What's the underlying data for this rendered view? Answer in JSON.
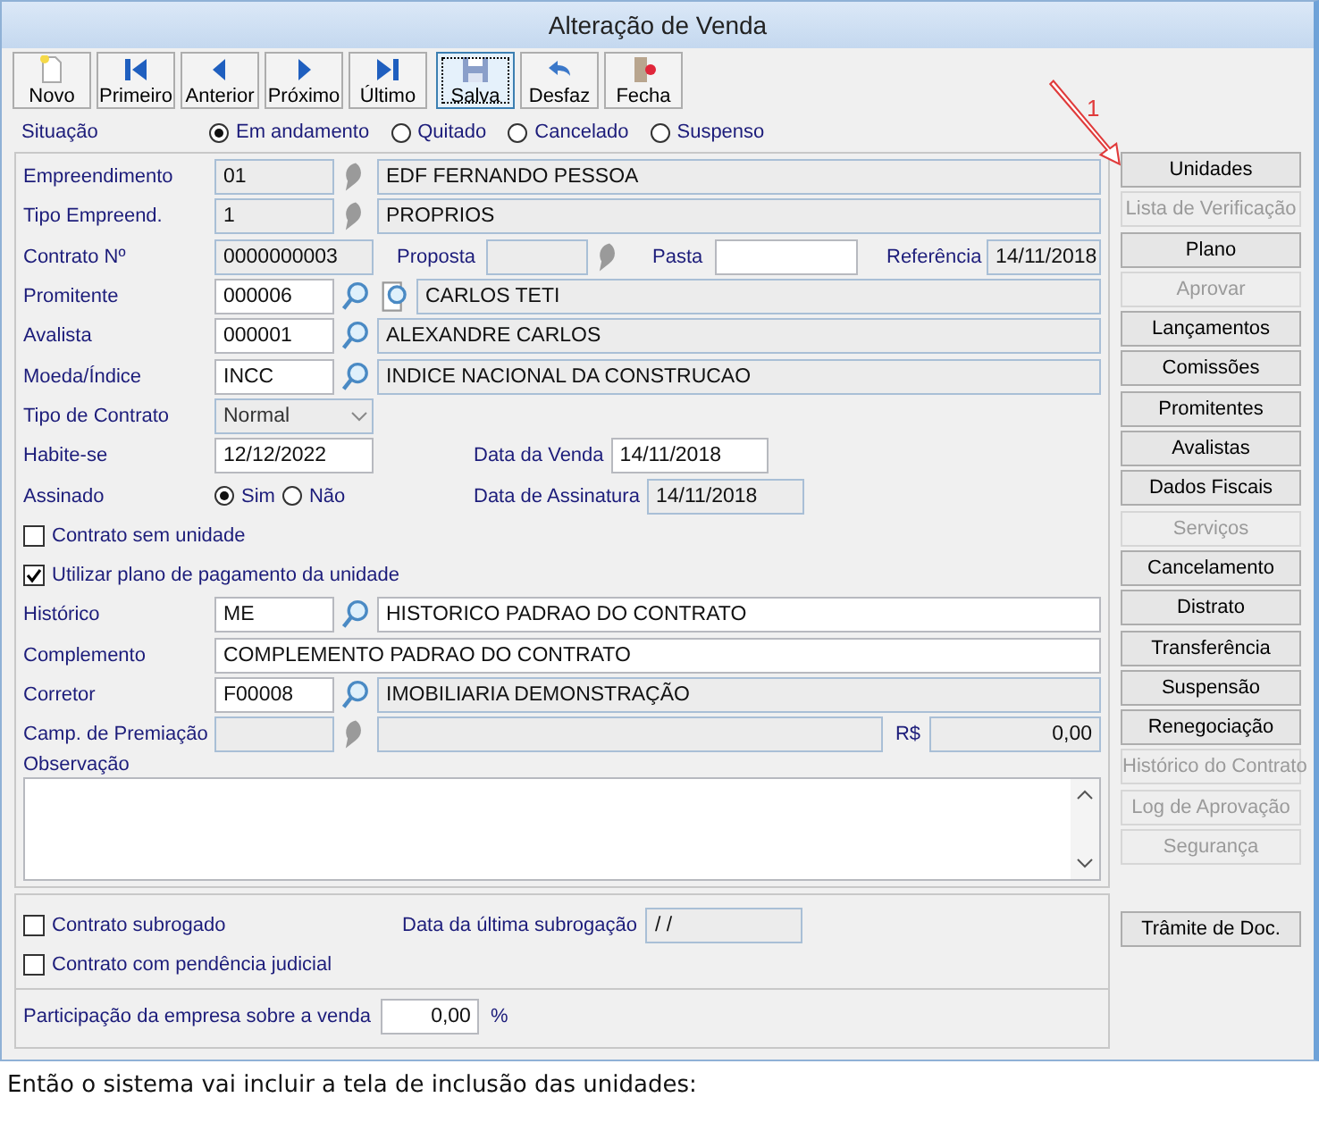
{
  "window": {
    "title": "Alteração de Venda"
  },
  "toolbar": [
    {
      "label": "Novo",
      "kind": "new",
      "focused": false
    },
    {
      "label": "Primeiro",
      "kind": "first",
      "focused": false
    },
    {
      "label": "Anterior",
      "kind": "prev",
      "focused": false
    },
    {
      "label": "Próximo",
      "kind": "next",
      "focused": false
    },
    {
      "label": "Último",
      "kind": "last",
      "focused": false
    },
    {
      "label": "Salva",
      "kind": "save",
      "focused": true
    },
    {
      "label": "Desfaz",
      "kind": "undo",
      "focused": false
    },
    {
      "label": "Fecha",
      "kind": "close",
      "focused": false
    }
  ],
  "situacao": {
    "label": "Situação",
    "options": [
      {
        "label": "Em andamento",
        "selected": true
      },
      {
        "label": "Quitado",
        "selected": false
      },
      {
        "label": "Cancelado",
        "selected": false
      },
      {
        "label": "Suspenso",
        "selected": false
      }
    ]
  },
  "rows": [
    {
      "kind": "lookup",
      "label": "Empreendimento",
      "code": {
        "value": "01",
        "editable": false
      },
      "lookup": {
        "enabled": false
      },
      "description": {
        "value": "EDF FERNANDO PESSOA",
        "editable": false
      }
    },
    {
      "kind": "lookup",
      "label": "Tipo Empreend.",
      "code": {
        "value": "1",
        "editable": false
      },
      "lookup": {
        "enabled": false
      },
      "description": {
        "value": "PROPRIOS",
        "editable": false
      }
    },
    {
      "kind": "contract",
      "label": "Contrato Nº",
      "number": {
        "value": "0000000003",
        "editable": false
      },
      "proposta_label": "Proposta",
      "proposta": {
        "editable": false
      },
      "proposta_lookup": {
        "enabled": false
      },
      "pasta_label": "Pasta",
      "pasta": {
        "editable": true
      },
      "referencia_label": "Referência",
      "referencia": {
        "value": "14/11/2018",
        "editable": false
      }
    },
    {
      "kind": "lookup",
      "label": "Promitente",
      "code": {
        "value": "000006",
        "editable": true
      },
      "lookup": {
        "enabled": true
      },
      "extra_lookup": {
        "enabled": true
      },
      "description": {
        "value": "CARLOS TETI",
        "editable": false
      }
    },
    {
      "kind": "lookup",
      "label": "Avalista",
      "code": {
        "value": "000001",
        "editable": true
      },
      "lookup": {
        "enabled": true
      },
      "description": {
        "value": "ALEXANDRE CARLOS",
        "editable": false
      }
    },
    {
      "kind": "lookup",
      "label": "Moeda/Índice",
      "code": {
        "value": "INCC",
        "editable": true
      },
      "lookup": {
        "enabled": true
      },
      "description": {
        "value": "INDICE NACIONAL DA CONSTRUCAO",
        "editable": false
      }
    },
    {
      "kind": "select",
      "label": "Tipo de Contrato",
      "value": "Normal",
      "disabled": true
    },
    {
      "kind": "date_pair",
      "label": "Habite-se",
      "field": {
        "value": "12/12/2022",
        "editable": true
      },
      "right_label": "Data da Venda",
      "right_field": {
        "value": "14/11/2018",
        "editable": true
      }
    },
    {
      "kind": "radio_date",
      "label": "Assinado",
      "options": [
        {
          "label": "Sim",
          "selected": true
        },
        {
          "label": "Não",
          "selected": false
        }
      ],
      "right_label": "Data de Assinatura",
      "right_field": {
        "value": "14/11/2018",
        "editable": false
      }
    },
    {
      "kind": "check",
      "label": "Contrato sem unidade",
      "checked": false
    },
    {
      "kind": "check",
      "label": "Utilizar plano de pagamento da unidade",
      "checked": true
    },
    {
      "kind": "lookup",
      "label": "Histórico",
      "code": {
        "value": "ME",
        "editable": true
      },
      "lookup": {
        "enabled": true
      },
      "description": {
        "value": "HISTORICO PADRAO DO CONTRATO",
        "editable": true
      }
    },
    {
      "kind": "text",
      "label": "Complemento",
      "field": {
        "value": "COMPLEMENTO PADRAO DO CONTRATO",
        "editable": true
      }
    },
    {
      "kind": "lookup",
      "label": "Corretor",
      "code": {
        "value": "F00008",
        "editable": true
      },
      "lookup": {
        "enabled": true
      },
      "description": {
        "value": "IMOBILIARIA DEMONSTRAÇÃO",
        "editable": false
      }
    },
    {
      "kind": "campaign",
      "label": "Camp. de Premiação",
      "code": {
        "editable": false
      },
      "lookup": {
        "enabled": false
      },
      "description": {
        "editable": false
      },
      "currency_label": "R$",
      "amount": {
        "value": "0,00",
        "editable": false
      }
    },
    {
      "kind": "memo",
      "label": "Observação"
    }
  ],
  "subrogacao": {
    "checks": [
      {
        "label": "Contrato subrogado",
        "checked": false
      },
      {
        "label": "Contrato com pendência judicial",
        "checked": false
      }
    ],
    "date_label": "Data da última subrogação",
    "date": {
      "value": "/ /",
      "editable": false
    }
  },
  "participacao": {
    "label": "Participação da empresa sobre a venda",
    "field": {
      "value": "0,00",
      "editable": true
    },
    "unit": "%"
  },
  "side_buttons": [
    {
      "label": "Unidades",
      "disabled": false,
      "kind": "action"
    },
    {
      "label": "Lista de Verificação",
      "disabled": true,
      "kind": "action"
    },
    {
      "label": "Plano",
      "disabled": false,
      "kind": "action"
    },
    {
      "label": "Aprovar",
      "disabled": true,
      "kind": "action"
    },
    {
      "label": "Lançamentos",
      "disabled": false,
      "kind": "action"
    },
    {
      "label": "Comissões",
      "disabled": false,
      "kind": "action"
    },
    {
      "label": "Promitentes",
      "disabled": false,
      "kind": "action"
    },
    {
      "label": "Avalistas",
      "disabled": false,
      "kind": "action"
    },
    {
      "label": "Dados Fiscais",
      "disabled": false,
      "kind": "action"
    },
    {
      "label": "Serviços",
      "disabled": true,
      "kind": "action"
    },
    {
      "label": "Cancelamento",
      "disabled": false,
      "kind": "action"
    },
    {
      "label": "Distrato",
      "disabled": false,
      "kind": "action"
    },
    {
      "label": "Transferência",
      "disabled": false,
      "kind": "action"
    },
    {
      "label": "Suspensão",
      "disabled": false,
      "kind": "action"
    },
    {
      "label": "Renegociação",
      "disabled": false,
      "kind": "action"
    },
    {
      "label": "Histórico do Contrato",
      "disabled": true,
      "kind": "action"
    },
    {
      "label": "Log de Aprovação",
      "disabled": true,
      "kind": "action"
    },
    {
      "label": "Segurança",
      "disabled": true,
      "kind": "action"
    },
    {
      "label": "Trâmite de Doc.",
      "disabled": false,
      "kind": "footer"
    }
  ],
  "annotation": {
    "label": "1"
  },
  "caption": "Então o sistema vai incluir a tela de inclusão das unidades:"
}
